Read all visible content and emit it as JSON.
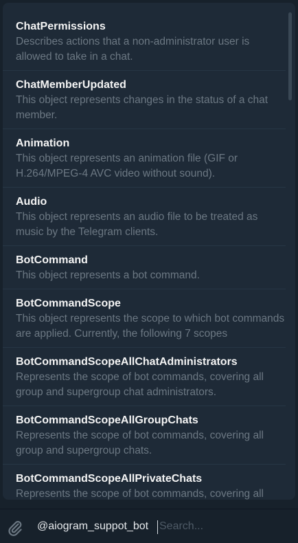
{
  "items": [
    {
      "title": "ChatPermissions",
      "desc": "Describes actions that a non-administrator user is allowed to take in a chat."
    },
    {
      "title": "ChatMemberUpdated",
      "desc": "This object represents changes in the status of a chat member."
    },
    {
      "title": "Animation",
      "desc": "This object represents an animation file (GIF or H.264/MPEG-4 AVC video without sound)."
    },
    {
      "title": "Audio",
      "desc": "This object represents an audio file to be treated as music by the Telegram clients."
    },
    {
      "title": "BotCommand",
      "desc": "This object represents a bot command."
    },
    {
      "title": "BotCommandScope",
      "desc": "This object represents the scope to which bot commands are applied. Currently, the following 7 scopes"
    },
    {
      "title": "BotCommandScopeAllChatAdministrators",
      "desc": "Represents the scope of bot commands, covering all group and supergroup chat administrators."
    },
    {
      "title": "BotCommandScopeAllGroupChats",
      "desc": "Represents the scope of bot commands, covering all group and supergroup chats."
    },
    {
      "title": "BotCommandScopeAllPrivateChats",
      "desc": "Represents the scope of bot commands, covering all private chats."
    }
  ],
  "input": {
    "mention": "@aiogram_suppot_bot",
    "placeholder": "Search..."
  },
  "icons": {
    "attach": "paperclip-icon"
  },
  "colors": {
    "background": "#17212b",
    "panel": "#1e2a37",
    "title": "#f5f5f5",
    "description": "#6c7883"
  }
}
